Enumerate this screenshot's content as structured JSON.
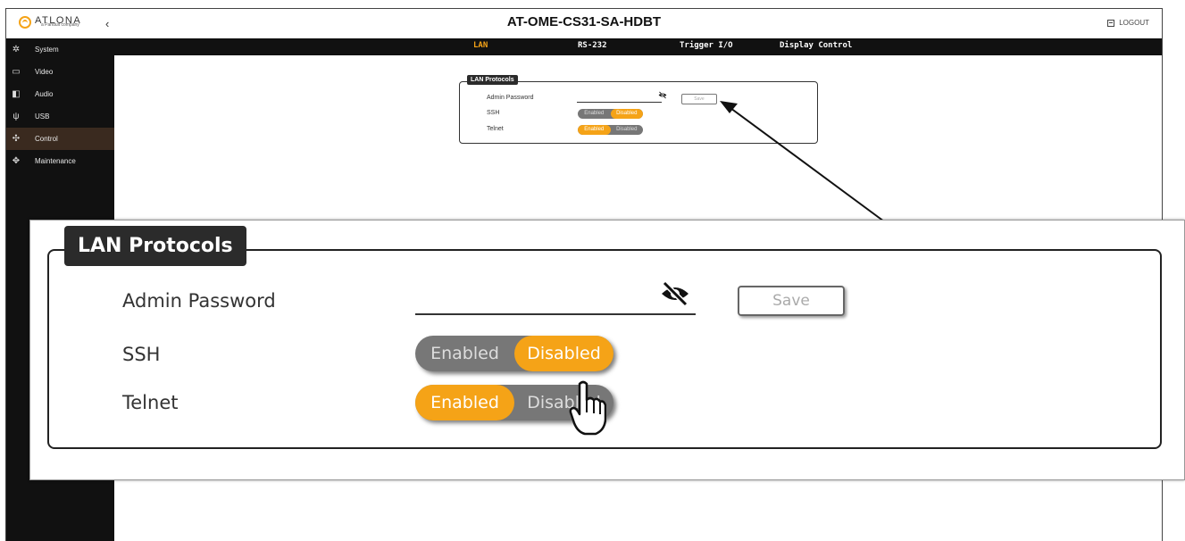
{
  "app": {
    "logo_text": "ATLONA",
    "logo_sub": "a Panduit company",
    "title": "AT-OME-CS31-SA-HDBT",
    "logout_label": "LOGOUT"
  },
  "sidebar": {
    "items": [
      {
        "label": "System",
        "icon": "gear-icon"
      },
      {
        "label": "Video",
        "icon": "monitor-icon"
      },
      {
        "label": "Audio",
        "icon": "speaker-icon"
      },
      {
        "label": "USB",
        "icon": "usb-icon"
      },
      {
        "label": "Control",
        "icon": "control-icon",
        "active": true
      },
      {
        "label": "Maintenance",
        "icon": "maintenance-icon"
      }
    ]
  },
  "tabs": [
    {
      "label": "LAN",
      "active": true
    },
    {
      "label": "RS-232"
    },
    {
      "label": "Trigger I/O"
    },
    {
      "label": "Display Control"
    }
  ],
  "lan_protocols": {
    "legend": "LAN Protocols",
    "admin_password_label": "Admin Password",
    "admin_password_value": "",
    "save_label": "Save",
    "ssh_label": "SSH",
    "telnet_label": "Telnet",
    "enabled_label": "Enabled",
    "disabled_label": "Disabled",
    "ssh_state": "Disabled",
    "telnet_state": "Enabled"
  },
  "colors": {
    "accent": "#f5a317",
    "sidebar_bg": "#111111",
    "active_item_bg": "#3a2a1f",
    "toggle_off": "#777777"
  }
}
